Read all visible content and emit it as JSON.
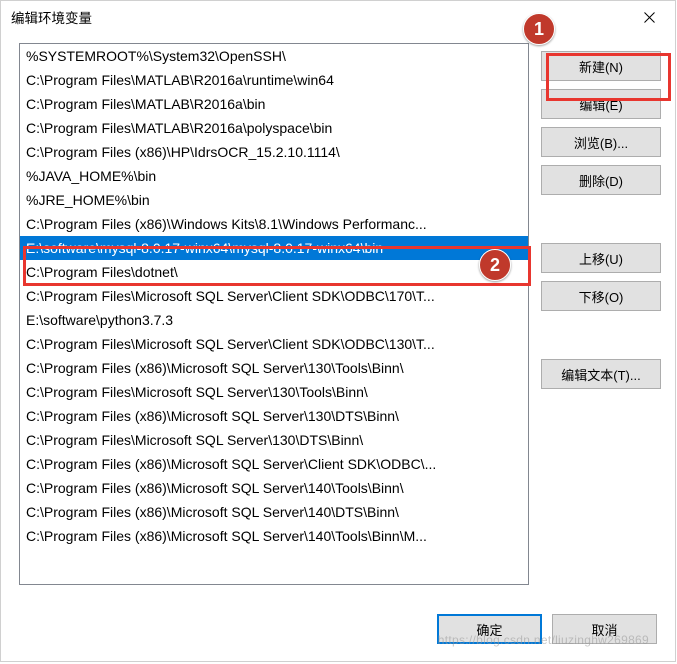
{
  "window": {
    "title": "编辑环境变量"
  },
  "list": {
    "selectedIndex": 8,
    "items": [
      "%SYSTEMROOT%\\System32\\OpenSSH\\",
      "C:\\Program Files\\MATLAB\\R2016a\\runtime\\win64",
      "C:\\Program Files\\MATLAB\\R2016a\\bin",
      "C:\\Program Files\\MATLAB\\R2016a\\polyspace\\bin",
      "C:\\Program Files (x86)\\HP\\IdrsOCR_15.2.10.1114\\",
      "%JAVA_HOME%\\bin",
      "%JRE_HOME%\\bin",
      "C:\\Program Files (x86)\\Windows Kits\\8.1\\Windows Performanc...",
      "E:\\software\\mysql-8.0.17-winx64\\mysql-8.0.17-winx64\\bin",
      "C:\\Program Files\\dotnet\\",
      "C:\\Program Files\\Microsoft SQL Server\\Client SDK\\ODBC\\170\\T...",
      "E:\\software\\python3.7.3",
      "C:\\Program Files\\Microsoft SQL Server\\Client SDK\\ODBC\\130\\T...",
      "C:\\Program Files (x86)\\Microsoft SQL Server\\130\\Tools\\Binn\\",
      "C:\\Program Files\\Microsoft SQL Server\\130\\Tools\\Binn\\",
      "C:\\Program Files (x86)\\Microsoft SQL Server\\130\\DTS\\Binn\\",
      "C:\\Program Files\\Microsoft SQL Server\\130\\DTS\\Binn\\",
      "C:\\Program Files (x86)\\Microsoft SQL Server\\Client SDK\\ODBC\\...",
      "C:\\Program Files (x86)\\Microsoft SQL Server\\140\\Tools\\Binn\\",
      "C:\\Program Files (x86)\\Microsoft SQL Server\\140\\DTS\\Binn\\",
      "C:\\Program Files (x86)\\Microsoft SQL Server\\140\\Tools\\Binn\\M..."
    ]
  },
  "buttons": {
    "new": "新建(N)",
    "edit": "编辑(E)",
    "browse": "浏览(B)...",
    "delete": "删除(D)",
    "moveUp": "上移(U)",
    "moveDown": "下移(O)",
    "editText": "编辑文本(T)...",
    "ok": "确定",
    "cancel": "取消"
  },
  "annotations": {
    "badge1": "1",
    "badge2": "2"
  },
  "watermark": "https://blog.csdn.net/liuzinghw269869"
}
